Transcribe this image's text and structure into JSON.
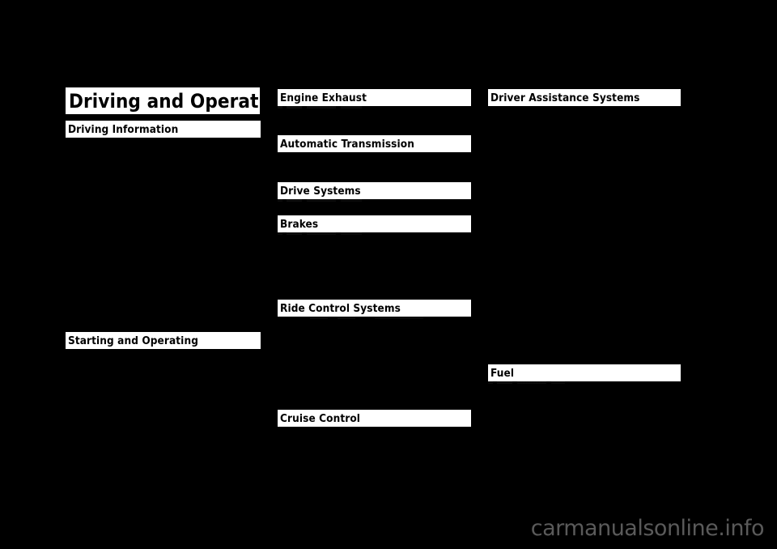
{
  "page": {
    "background_color": "#000000",
    "header_bar_color": "#ffffff",
    "header_text_color": "#000000",
    "body_text_color": "#000000",
    "watermark_color": "#5a5a5a"
  },
  "chapter": {
    "title": "Driving and Operating"
  },
  "columns": {
    "left": {
      "sections": [
        {
          "heading": "Driving Information"
        },
        {
          "heading": "Starting and Operating"
        }
      ]
    },
    "middle": {
      "sections": [
        {
          "heading": "Engine Exhaust"
        },
        {
          "heading": "Automatic Transmission"
        },
        {
          "heading": "Drive Systems"
        },
        {
          "heading": "Brakes"
        },
        {
          "heading": "Ride Control Systems"
        },
        {
          "heading": "Cruise Control"
        }
      ]
    },
    "right": {
      "sections": [
        {
          "heading": "Driver Assistance Systems"
        },
        {
          "heading": "Fuel"
        }
      ]
    }
  },
  "watermark": {
    "text": "carmanualsonline.info"
  }
}
